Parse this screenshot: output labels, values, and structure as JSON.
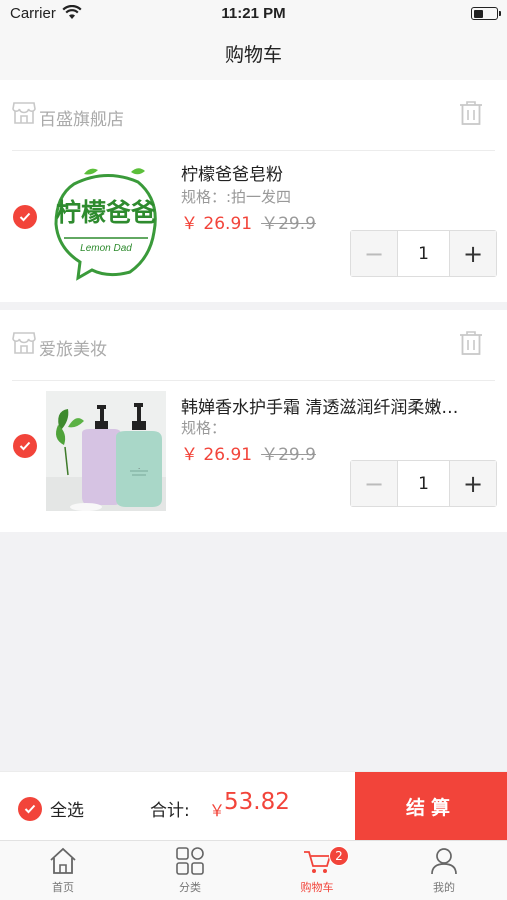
{
  "status_bar": {
    "carrier": "Carrier",
    "time": "11:21 PM",
    "battery_level": 0.45
  },
  "nav": {
    "title": "购物车"
  },
  "stores": [
    {
      "name": "百盛旗舰店",
      "item": {
        "title": "柠檬爸爸皂粉",
        "spec": "规格：:拍一发四",
        "price": "￥ 26.91",
        "original_price": "￥29.9",
        "quantity": "1",
        "logo_text": "柠檬爸爸",
        "logo_subtext": "Lemon Dad"
      }
    },
    {
      "name": "爱旅美妆",
      "item": {
        "title": "韩婵香水护手霜 清透滋润纤润柔嫩…",
        "spec": "规格：",
        "price": "￥ 26.91",
        "original_price": "￥29.9",
        "quantity": "1"
      }
    }
  ],
  "stepper": {
    "minus": "−",
    "plus": "+"
  },
  "checkout": {
    "select_all_label": "全选",
    "total_label": "合计:",
    "currency": "￥",
    "total_value": "53.82",
    "button_label": "结算"
  },
  "tabs": [
    {
      "label": "首页",
      "icon": "home-icon"
    },
    {
      "label": "分类",
      "icon": "category-icon"
    },
    {
      "label": "购物车",
      "icon": "cart-icon",
      "badge": "2",
      "active": true
    },
    {
      "label": "我的",
      "icon": "profile-icon"
    }
  ],
  "colors": {
    "accent": "#f2443a",
    "background": "#f2f2f4"
  }
}
